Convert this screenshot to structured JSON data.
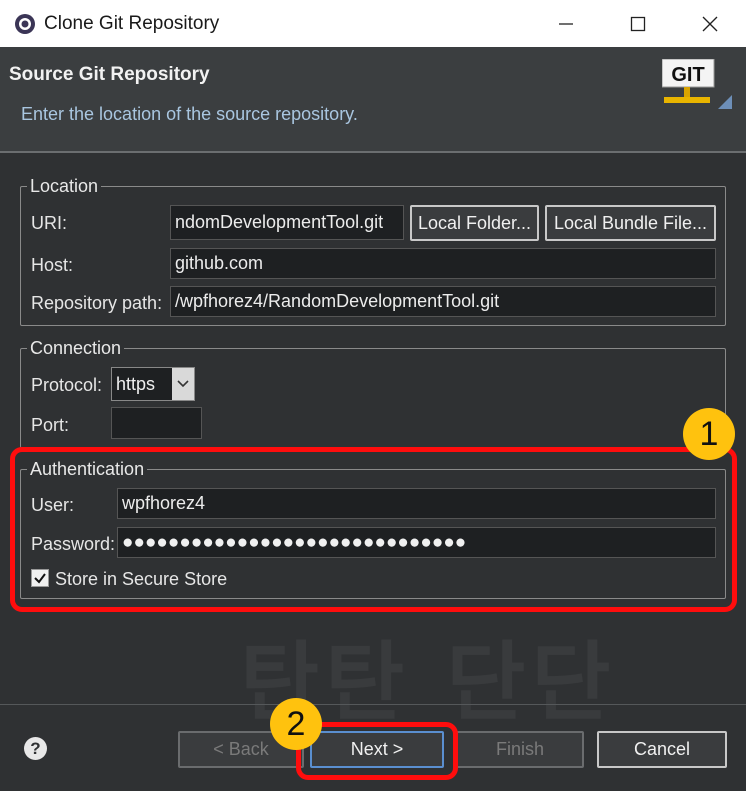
{
  "window": {
    "title": "Clone Git Repository",
    "minimize_glyph": "—",
    "maximize_glyph": "☐",
    "close_glyph": "✕"
  },
  "header": {
    "title": "Source Git Repository",
    "description": "Enter the location of the source repository.",
    "logo_text": "GIT"
  },
  "location": {
    "legend": "Location",
    "uri_label": "URI:",
    "uri_value": "ndomDevelopmentTool.git",
    "local_folder_button": "Local Folder...",
    "local_bundle_button": "Local Bundle File...",
    "host_label": "Host:",
    "host_value": "github.com",
    "repo_path_label": "Repository path:",
    "repo_path_value": "/wpfhorez4/RandomDevelopmentTool.git"
  },
  "connection": {
    "legend": "Connection",
    "protocol_label": "Protocol:",
    "protocol_value": "https",
    "port_label": "Port:",
    "port_value": ""
  },
  "authentication": {
    "legend": "Authentication",
    "user_label": "User:",
    "user_value": "wpfhorez4",
    "password_label": "Password:",
    "password_value": "●●●●●●●●●●●●●●●●●●●●●●●●●●●●●●",
    "store_checkbox_label": "Store in Secure Store",
    "store_checked": true
  },
  "footer": {
    "back_button": "< Back",
    "next_button": "Next >",
    "finish_button": "Finish",
    "cancel_button": "Cancel"
  },
  "watermark": "탄탄 단단",
  "annotations": {
    "badge_1": "1",
    "badge_2": "2",
    "color": "#ff0d0d",
    "badge_color": "#ffc20e"
  },
  "colors": {
    "background": "#2f3133",
    "header_desc": "#a9c6e0"
  }
}
